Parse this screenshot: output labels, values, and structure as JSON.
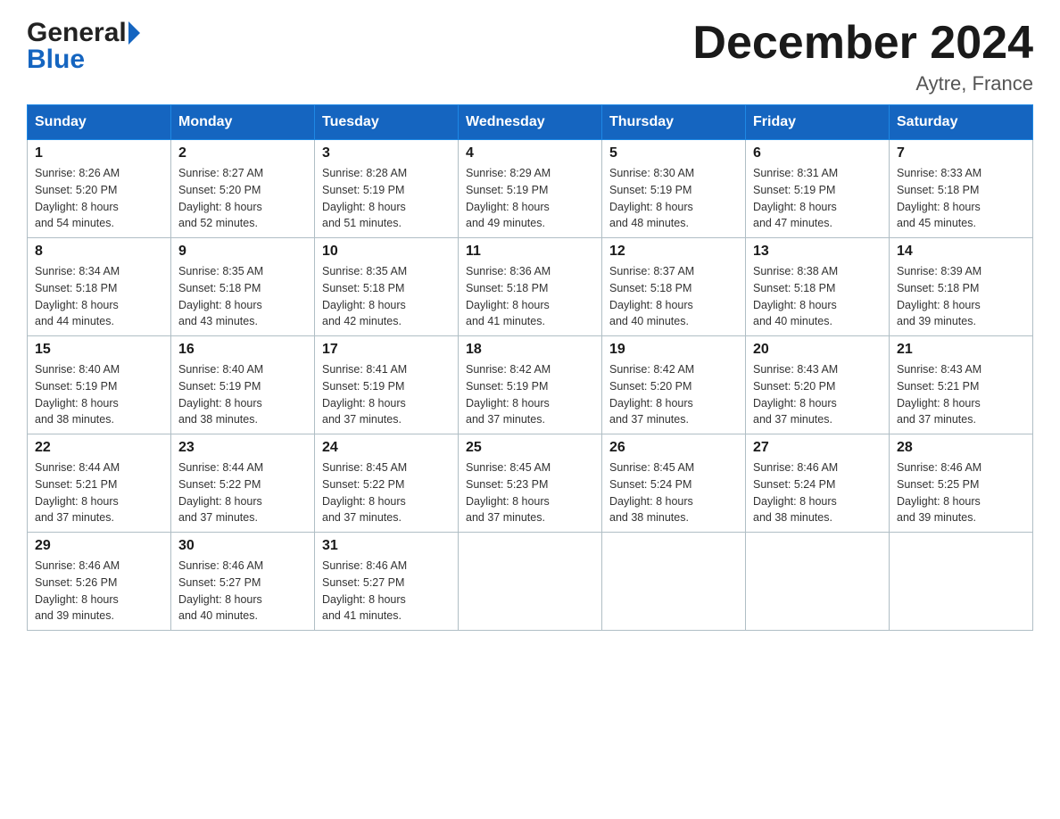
{
  "header": {
    "logo_general": "General",
    "logo_blue": "Blue",
    "title": "December 2024",
    "subtitle": "Aytre, France"
  },
  "calendar": {
    "days_of_week": [
      "Sunday",
      "Monday",
      "Tuesday",
      "Wednesday",
      "Thursday",
      "Friday",
      "Saturday"
    ],
    "weeks": [
      [
        {
          "day": "1",
          "sunrise": "8:26 AM",
          "sunset": "5:20 PM",
          "daylight": "8 hours and 54 minutes."
        },
        {
          "day": "2",
          "sunrise": "8:27 AM",
          "sunset": "5:20 PM",
          "daylight": "8 hours and 52 minutes."
        },
        {
          "day": "3",
          "sunrise": "8:28 AM",
          "sunset": "5:19 PM",
          "daylight": "8 hours and 51 minutes."
        },
        {
          "day": "4",
          "sunrise": "8:29 AM",
          "sunset": "5:19 PM",
          "daylight": "8 hours and 49 minutes."
        },
        {
          "day": "5",
          "sunrise": "8:30 AM",
          "sunset": "5:19 PM",
          "daylight": "8 hours and 48 minutes."
        },
        {
          "day": "6",
          "sunrise": "8:31 AM",
          "sunset": "5:19 PM",
          "daylight": "8 hours and 47 minutes."
        },
        {
          "day": "7",
          "sunrise": "8:33 AM",
          "sunset": "5:18 PM",
          "daylight": "8 hours and 45 minutes."
        }
      ],
      [
        {
          "day": "8",
          "sunrise": "8:34 AM",
          "sunset": "5:18 PM",
          "daylight": "8 hours and 44 minutes."
        },
        {
          "day": "9",
          "sunrise": "8:35 AM",
          "sunset": "5:18 PM",
          "daylight": "8 hours and 43 minutes."
        },
        {
          "day": "10",
          "sunrise": "8:35 AM",
          "sunset": "5:18 PM",
          "daylight": "8 hours and 42 minutes."
        },
        {
          "day": "11",
          "sunrise": "8:36 AM",
          "sunset": "5:18 PM",
          "daylight": "8 hours and 41 minutes."
        },
        {
          "day": "12",
          "sunrise": "8:37 AM",
          "sunset": "5:18 PM",
          "daylight": "8 hours and 40 minutes."
        },
        {
          "day": "13",
          "sunrise": "8:38 AM",
          "sunset": "5:18 PM",
          "daylight": "8 hours and 40 minutes."
        },
        {
          "day": "14",
          "sunrise": "8:39 AM",
          "sunset": "5:18 PM",
          "daylight": "8 hours and 39 minutes."
        }
      ],
      [
        {
          "day": "15",
          "sunrise": "8:40 AM",
          "sunset": "5:19 PM",
          "daylight": "8 hours and 38 minutes."
        },
        {
          "day": "16",
          "sunrise": "8:40 AM",
          "sunset": "5:19 PM",
          "daylight": "8 hours and 38 minutes."
        },
        {
          "day": "17",
          "sunrise": "8:41 AM",
          "sunset": "5:19 PM",
          "daylight": "8 hours and 37 minutes."
        },
        {
          "day": "18",
          "sunrise": "8:42 AM",
          "sunset": "5:19 PM",
          "daylight": "8 hours and 37 minutes."
        },
        {
          "day": "19",
          "sunrise": "8:42 AM",
          "sunset": "5:20 PM",
          "daylight": "8 hours and 37 minutes."
        },
        {
          "day": "20",
          "sunrise": "8:43 AM",
          "sunset": "5:20 PM",
          "daylight": "8 hours and 37 minutes."
        },
        {
          "day": "21",
          "sunrise": "8:43 AM",
          "sunset": "5:21 PM",
          "daylight": "8 hours and 37 minutes."
        }
      ],
      [
        {
          "day": "22",
          "sunrise": "8:44 AM",
          "sunset": "5:21 PM",
          "daylight": "8 hours and 37 minutes."
        },
        {
          "day": "23",
          "sunrise": "8:44 AM",
          "sunset": "5:22 PM",
          "daylight": "8 hours and 37 minutes."
        },
        {
          "day": "24",
          "sunrise": "8:45 AM",
          "sunset": "5:22 PM",
          "daylight": "8 hours and 37 minutes."
        },
        {
          "day": "25",
          "sunrise": "8:45 AM",
          "sunset": "5:23 PM",
          "daylight": "8 hours and 37 minutes."
        },
        {
          "day": "26",
          "sunrise": "8:45 AM",
          "sunset": "5:24 PM",
          "daylight": "8 hours and 38 minutes."
        },
        {
          "day": "27",
          "sunrise": "8:46 AM",
          "sunset": "5:24 PM",
          "daylight": "8 hours and 38 minutes."
        },
        {
          "day": "28",
          "sunrise": "8:46 AM",
          "sunset": "5:25 PM",
          "daylight": "8 hours and 39 minutes."
        }
      ],
      [
        {
          "day": "29",
          "sunrise": "8:46 AM",
          "sunset": "5:26 PM",
          "daylight": "8 hours and 39 minutes."
        },
        {
          "day": "30",
          "sunrise": "8:46 AM",
          "sunset": "5:27 PM",
          "daylight": "8 hours and 40 minutes."
        },
        {
          "day": "31",
          "sunrise": "8:46 AM",
          "sunset": "5:27 PM",
          "daylight": "8 hours and 41 minutes."
        },
        null,
        null,
        null,
        null
      ]
    ],
    "labels": {
      "sunrise": "Sunrise:",
      "sunset": "Sunset:",
      "daylight": "Daylight:"
    }
  }
}
